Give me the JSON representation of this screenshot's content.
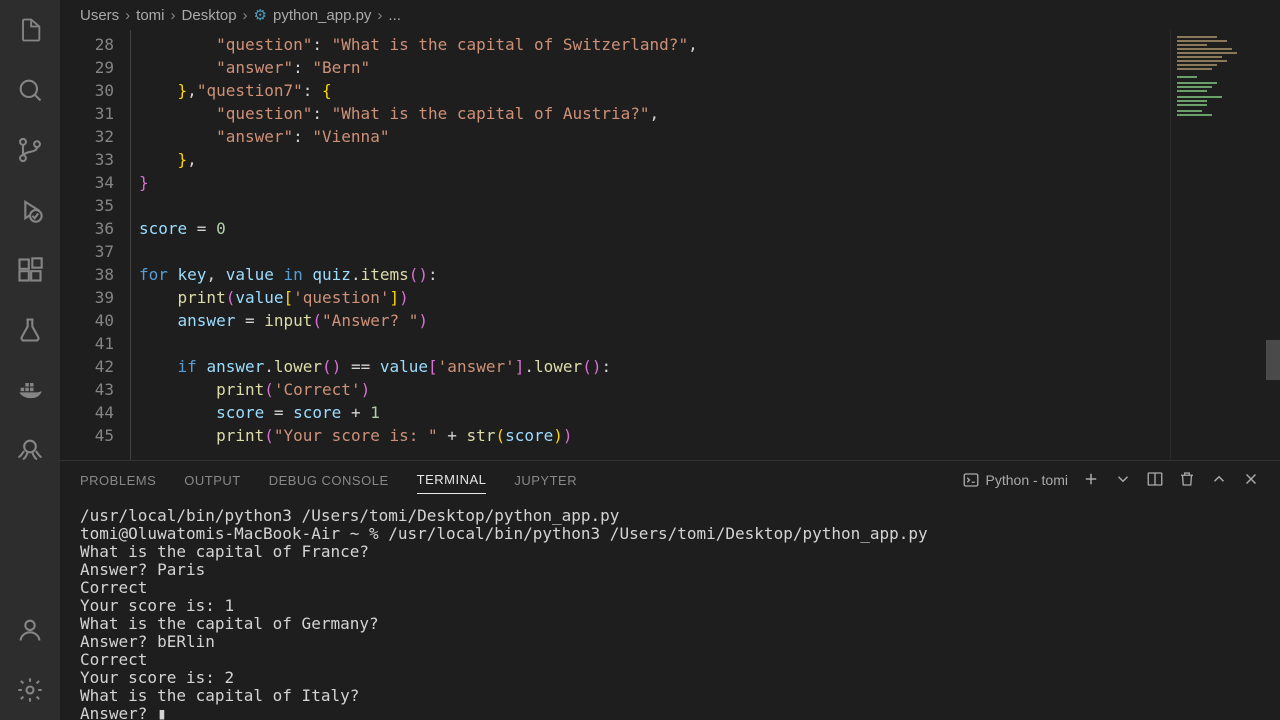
{
  "breadcrumb": {
    "parts": [
      "Users",
      "tomi",
      "Desktop",
      "python_app.py",
      "..."
    ],
    "file_icon": "py"
  },
  "activity_bar": {
    "top": [
      "files-icon",
      "search-icon",
      "branch-icon",
      "debug-icon",
      "extensions-icon",
      "beaker-icon",
      "docker-icon",
      "octopus-icon"
    ],
    "bottom": [
      "account-icon",
      "gear-icon"
    ]
  },
  "editor": {
    "first_line": 28,
    "lines": [
      {
        "n": 28,
        "indent": 8,
        "tokens": [
          [
            "str",
            "\"question\""
          ],
          [
            "op",
            ": "
          ],
          [
            "str",
            "\"What is the capital of Switzerland?\""
          ],
          [
            "op",
            ","
          ]
        ]
      },
      {
        "n": 29,
        "indent": 8,
        "tokens": [
          [
            "str",
            "\"answer\""
          ],
          [
            "op",
            ": "
          ],
          [
            "str",
            "\"Bern\""
          ]
        ]
      },
      {
        "n": 30,
        "indent": 4,
        "tokens": [
          [
            "brace2",
            "}"
          ],
          [
            "op",
            ","
          ],
          [
            "str",
            "\"question7\""
          ],
          [
            "op",
            ": "
          ],
          [
            "brace2",
            "{"
          ]
        ]
      },
      {
        "n": 31,
        "indent": 8,
        "tokens": [
          [
            "str",
            "\"question\""
          ],
          [
            "op",
            ": "
          ],
          [
            "str",
            "\"What is the capital of Austria?\""
          ],
          [
            "op",
            ","
          ]
        ]
      },
      {
        "n": 32,
        "indent": 8,
        "tokens": [
          [
            "str",
            "\"answer\""
          ],
          [
            "op",
            ": "
          ],
          [
            "str",
            "\"Vienna\""
          ]
        ]
      },
      {
        "n": 33,
        "indent": 4,
        "tokens": [
          [
            "brace2",
            "}"
          ],
          [
            "op",
            ","
          ]
        ]
      },
      {
        "n": 34,
        "indent": 0,
        "tokens": [
          [
            "brace",
            "}"
          ]
        ]
      },
      {
        "n": 35,
        "indent": 0,
        "tokens": []
      },
      {
        "n": 36,
        "indent": 0,
        "tokens": [
          [
            "var",
            "score"
          ],
          [
            "op",
            " = "
          ],
          [
            "num",
            "0"
          ]
        ]
      },
      {
        "n": 37,
        "indent": 0,
        "tokens": []
      },
      {
        "n": 38,
        "indent": 0,
        "tokens": [
          [
            "key",
            "for "
          ],
          [
            "var",
            "key"
          ],
          [
            "op",
            ", "
          ],
          [
            "var",
            "value"
          ],
          [
            "key",
            " in "
          ],
          [
            "var",
            "quiz"
          ],
          [
            "op",
            "."
          ],
          [
            "fn",
            "items"
          ],
          [
            "brace",
            "("
          ],
          [
            "brace",
            ")"
          ],
          [
            "op",
            ":"
          ]
        ]
      },
      {
        "n": 39,
        "indent": 4,
        "tokens": [
          [
            "fn",
            "print"
          ],
          [
            "brace",
            "("
          ],
          [
            "var",
            "value"
          ],
          [
            "brace2",
            "["
          ],
          [
            "str",
            "'question'"
          ],
          [
            "brace2",
            "]"
          ],
          [
            "brace",
            ")"
          ]
        ]
      },
      {
        "n": 40,
        "indent": 4,
        "tokens": [
          [
            "var",
            "answer"
          ],
          [
            "op",
            " = "
          ],
          [
            "fn",
            "input"
          ],
          [
            "brace",
            "("
          ],
          [
            "str",
            "\"Answer? \""
          ],
          [
            "brace",
            ")"
          ]
        ]
      },
      {
        "n": 41,
        "indent": 0,
        "tokens": []
      },
      {
        "n": 42,
        "indent": 4,
        "tokens": [
          [
            "key",
            "if "
          ],
          [
            "var",
            "answer"
          ],
          [
            "op",
            "."
          ],
          [
            "fn",
            "lower"
          ],
          [
            "brace",
            "("
          ],
          [
            "brace",
            ")"
          ],
          [
            "op",
            " == "
          ],
          [
            "var",
            "value"
          ],
          [
            "brace",
            "["
          ],
          [
            "str",
            "'answer'"
          ],
          [
            "brace",
            "]"
          ],
          [
            "op",
            "."
          ],
          [
            "fn",
            "lower"
          ],
          [
            "brace",
            "("
          ],
          [
            "brace",
            ")"
          ],
          [
            "op",
            ":"
          ]
        ]
      },
      {
        "n": 43,
        "indent": 8,
        "tokens": [
          [
            "fn",
            "print"
          ],
          [
            "brace",
            "("
          ],
          [
            "str",
            "'Correct'"
          ],
          [
            "brace",
            ")"
          ]
        ]
      },
      {
        "n": 44,
        "indent": 8,
        "tokens": [
          [
            "var",
            "score"
          ],
          [
            "op",
            " = "
          ],
          [
            "var",
            "score"
          ],
          [
            "op",
            " + "
          ],
          [
            "num",
            "1"
          ]
        ]
      },
      {
        "n": 45,
        "indent": 8,
        "tokens": [
          [
            "fn",
            "print"
          ],
          [
            "brace",
            "("
          ],
          [
            "str",
            "\"Your score is: \""
          ],
          [
            "op",
            " + "
          ],
          [
            "fn",
            "str"
          ],
          [
            "brace2",
            "("
          ],
          [
            "var",
            "score"
          ],
          [
            "brace2",
            ")"
          ],
          [
            "brace",
            ")"
          ]
        ]
      }
    ]
  },
  "panel": {
    "tabs": [
      "PROBLEMS",
      "OUTPUT",
      "DEBUG CONSOLE",
      "TERMINAL",
      "JUPYTER"
    ],
    "active_tab": 3,
    "terminal_label": "Python - tomi",
    "terminal_lines": [
      "/usr/local/bin/python3 /Users/tomi/Desktop/python_app.py",
      "tomi@Oluwatomis-MacBook-Air ~ % /usr/local/bin/python3 /Users/tomi/Desktop/python_app.py",
      "What is the capital of France?",
      "Answer? Paris",
      "Correct",
      "Your score is: 1",
      "What is the capital of Germany?",
      "Answer? bERlin",
      "Correct",
      "Your score is: 2",
      "What is the capital of Italy?",
      "Answer? "
    ]
  }
}
